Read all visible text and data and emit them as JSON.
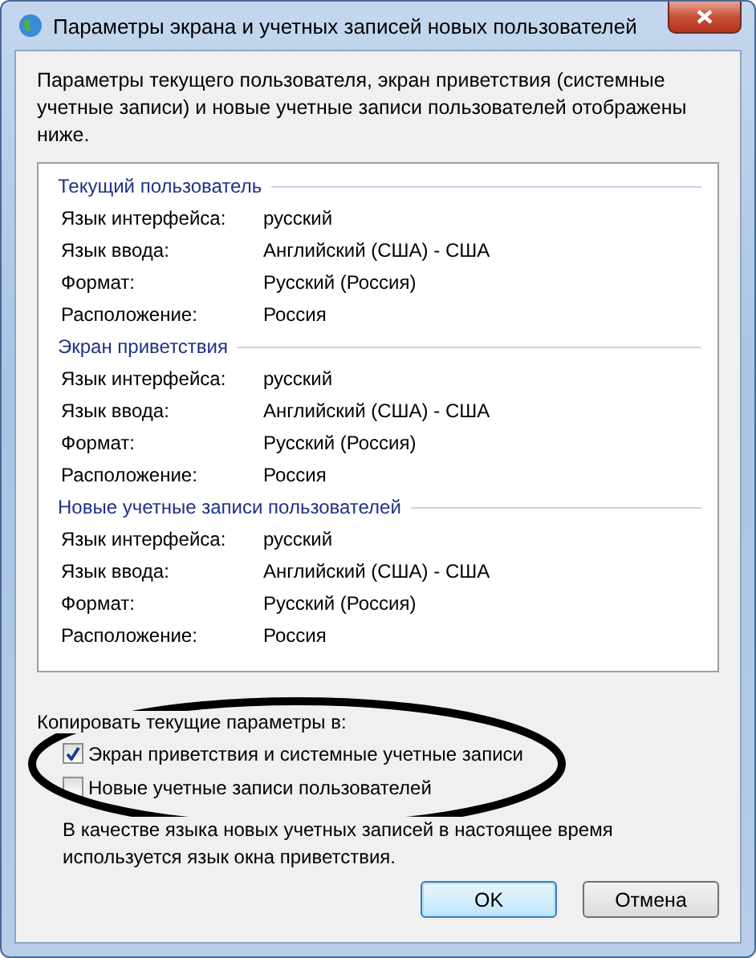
{
  "window": {
    "title": "Параметры экрана и учетных записей новых пользователей"
  },
  "intro": "Параметры текущего пользователя, экран приветствия (системные учетные записи) и новые учетные записи пользователей отображены ниже.",
  "sections": [
    {
      "title": "Текущий пользователь",
      "rows": [
        {
          "label": "Язык интерфейса:",
          "value": "русский"
        },
        {
          "label": "Язык ввода:",
          "value": "Английский (США) - США"
        },
        {
          "label": "Формат:",
          "value": "Русский (Россия)"
        },
        {
          "label": "Расположение:",
          "value": "Россия"
        }
      ]
    },
    {
      "title": "Экран приветствия",
      "rows": [
        {
          "label": "Язык интерфейса:",
          "value": "русский"
        },
        {
          "label": "Язык ввода:",
          "value": "Английский (США) - США"
        },
        {
          "label": "Формат:",
          "value": "Русский (Россия)"
        },
        {
          "label": "Расположение:",
          "value": "Россия"
        }
      ]
    },
    {
      "title": "Новые учетные записи пользователей",
      "rows": [
        {
          "label": "Язык интерфейса:",
          "value": "русский"
        },
        {
          "label": "Язык ввода:",
          "value": "Английский (США) - США"
        },
        {
          "label": "Формат:",
          "value": "Русский (Россия)"
        },
        {
          "label": "Расположение:",
          "value": "Россия"
        }
      ]
    }
  ],
  "copy_label": "Копировать текущие параметры в:",
  "checkboxes": [
    {
      "label": "Экран приветствия и системные учетные записи",
      "checked": true
    },
    {
      "label": "Новые учетные записи пользователей",
      "checked": false
    }
  ],
  "note": "В качестве языка новых учетных записей в настоящее время используется язык окна приветствия.",
  "buttons": [
    {
      "label": "OK",
      "kind": "default"
    },
    {
      "label": "Отмена",
      "kind": "normal"
    }
  ]
}
